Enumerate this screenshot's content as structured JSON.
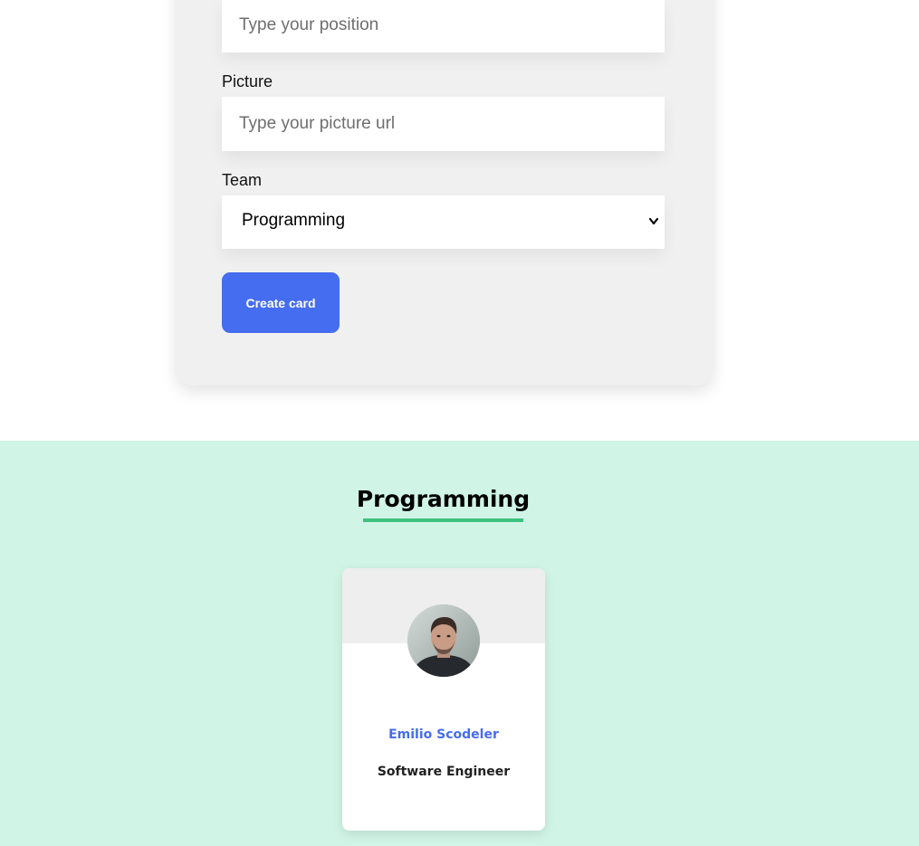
{
  "form": {
    "position_input": {
      "placeholder": "Type your position",
      "value": ""
    },
    "picture_field": {
      "label": "Picture",
      "placeholder": "Type your picture url",
      "value": ""
    },
    "team_field": {
      "label": "Team",
      "selected": "Programming"
    },
    "submit_label": "Create card"
  },
  "team_section": {
    "title": "Programming",
    "colors": {
      "background": "#d0f4e6",
      "underline": "#3fc17f"
    },
    "members": [
      {
        "name": "Emilio Scodeler",
        "position": "Software Engineer",
        "avatar_icon": "user-photo"
      }
    ]
  },
  "colors": {
    "accent": "#456def",
    "form_background": "#f0f0f0"
  }
}
